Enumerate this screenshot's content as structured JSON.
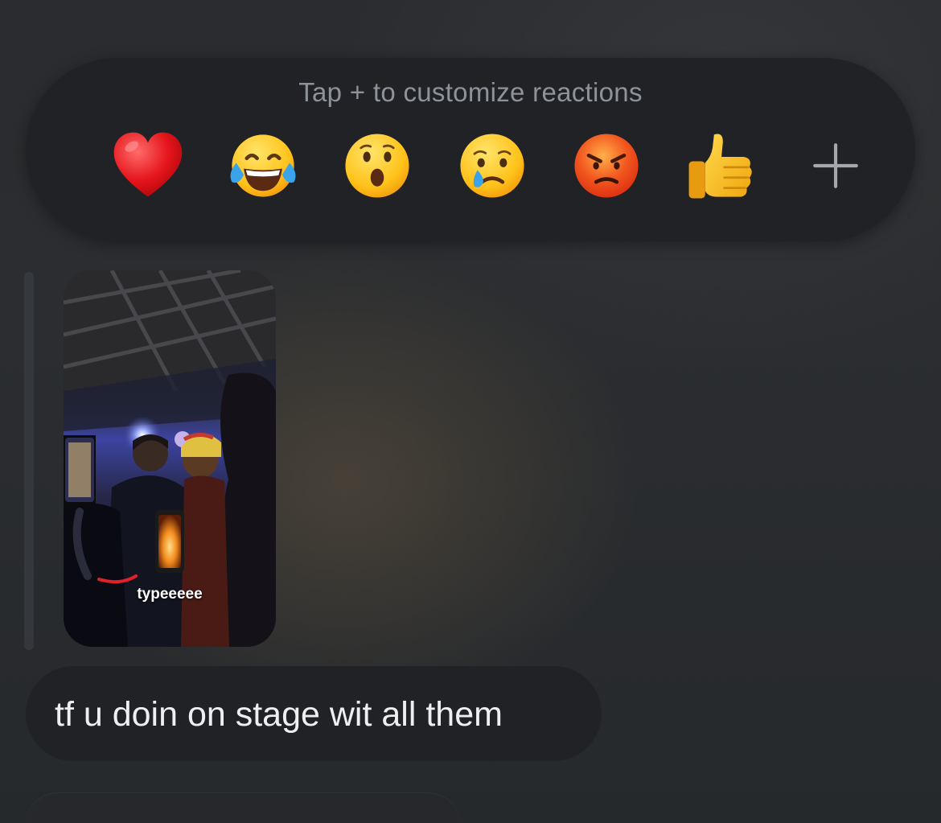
{
  "reaction_picker": {
    "hint": "Tap + to customize reactions",
    "reactions": [
      {
        "icon": "red-heart-icon"
      },
      {
        "icon": "face-with-tears-of-joy-icon"
      },
      {
        "icon": "face-with-open-mouth-icon"
      },
      {
        "icon": "crying-face-icon"
      },
      {
        "icon": "angry-face-icon"
      },
      {
        "icon": "thumbs-up-icon"
      },
      {
        "icon": "plus-icon"
      }
    ]
  },
  "message": {
    "video_caption": "typeeeee",
    "text": "tf u doin on stage wit all them"
  },
  "colors": {
    "background": "#2a2c2f",
    "bubble": "#202225",
    "hint_text": "#8e939b",
    "message_text": "#eeeff1"
  }
}
